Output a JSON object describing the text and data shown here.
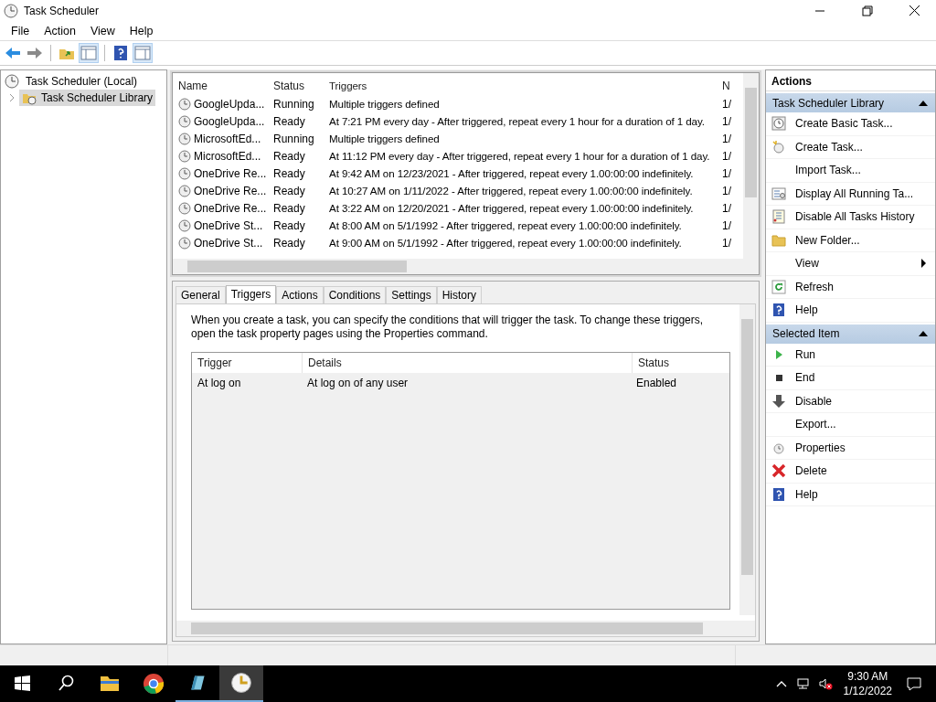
{
  "window": {
    "title": "Task Scheduler"
  },
  "menu": [
    "File",
    "Action",
    "View",
    "Help"
  ],
  "tree": [
    {
      "label": "Task Scheduler (Local)",
      "selected": false,
      "children": [
        {
          "label": "Task Scheduler Library",
          "selected": true,
          "expanded": false
        }
      ]
    }
  ],
  "task_list": {
    "columns": [
      "Name",
      "Status",
      "Triggers",
      "N"
    ],
    "rows": [
      {
        "name": "GoogleUpda...",
        "status": "Running",
        "triggers": "Multiple triggers defined",
        "column_4": "1/"
      },
      {
        "name": "GoogleUpda...",
        "status": "Ready",
        "triggers": "At 7:21 PM every day - After triggered, repeat every 1 hour for a duration of 1 day.",
        "column_4": "1/"
      },
      {
        "name": "MicrosoftEd...",
        "status": "Running",
        "triggers": "Multiple triggers defined",
        "column_4": "1/"
      },
      {
        "name": "MicrosoftEd...",
        "status": "Ready",
        "triggers": "At 11:12 PM every day - After triggered, repeat every 1 hour for a duration of 1 day.",
        "column_4": "1/"
      },
      {
        "name": "OneDrive Re...",
        "status": "Ready",
        "triggers": "At 9:42 AM on 12/23/2021 - After triggered, repeat every 1.00:00:00 indefinitely.",
        "column_4": "1/"
      },
      {
        "name": "OneDrive Re...",
        "status": "Ready",
        "triggers": "At 10:27 AM on 1/11/2022 - After triggered, repeat every 1.00:00:00 indefinitely.",
        "column_4": "1/"
      },
      {
        "name": "OneDrive Re...",
        "status": "Ready",
        "triggers": "At 3:22 AM on 12/20/2021 - After triggered, repeat every 1.00:00:00 indefinitely.",
        "column_4": "1/"
      },
      {
        "name": "OneDrive St...",
        "status": "Ready",
        "triggers": "At 8:00 AM on 5/1/1992 - After triggered, repeat every 1.00:00:00 indefinitely.",
        "column_4": "1/"
      },
      {
        "name": "OneDrive St...",
        "status": "Ready",
        "triggers": "At 9:00 AM on 5/1/1992 - After triggered, repeat every 1.00:00:00 indefinitely.",
        "column_4": "1/"
      }
    ]
  },
  "tabs": [
    {
      "label": "General",
      "selected": false
    },
    {
      "label": "Triggers",
      "selected": true
    },
    {
      "label": "Actions",
      "selected": false
    },
    {
      "label": "Conditions",
      "selected": false
    },
    {
      "label": "Settings",
      "selected": false
    },
    {
      "label": "History",
      "selected": false
    }
  ],
  "description": "When you create a task, you can specify the conditions that will trigger the task.  To change these triggers, open the task property pages using the Properties command.",
  "triggers_table": {
    "columns": [
      "Trigger",
      "Details",
      "Status"
    ],
    "rows": [
      {
        "trigger": "At log on",
        "details": "At log on of any user",
        "status": "Enabled"
      }
    ]
  },
  "actions_pane": {
    "title": "Actions",
    "sections": [
      {
        "title": "Task Scheduler Library",
        "expanded": true,
        "items": [
          {
            "label": "Create Basic Task...",
            "kind": "wizard"
          },
          {
            "label": "Create Task...",
            "kind": "newtask"
          },
          {
            "label": "Import Task...",
            "kind": "plain"
          },
          {
            "label": "Display All Running Ta...",
            "kind": "running"
          },
          {
            "label": "Disable All Tasks History",
            "kind": "history"
          },
          {
            "label": "New Folder...",
            "kind": "folder"
          },
          {
            "label": "View",
            "kind": "submenu"
          },
          {
            "label": "Refresh",
            "kind": "refresh"
          },
          {
            "label": "Help",
            "kind": "help"
          }
        ]
      },
      {
        "title": "Selected Item",
        "expanded": true,
        "items": [
          {
            "label": "Run",
            "kind": "run"
          },
          {
            "label": "End",
            "kind": "end"
          },
          {
            "label": "Disable",
            "kind": "disable"
          },
          {
            "label": "Export...",
            "kind": "plain"
          },
          {
            "label": "Properties",
            "kind": "clock"
          },
          {
            "label": "Delete",
            "kind": "delete"
          },
          {
            "label": "Help",
            "kind": "help"
          }
        ]
      }
    ]
  },
  "taskbar": {
    "time": "9:30 AM",
    "date": "1/12/2022"
  }
}
